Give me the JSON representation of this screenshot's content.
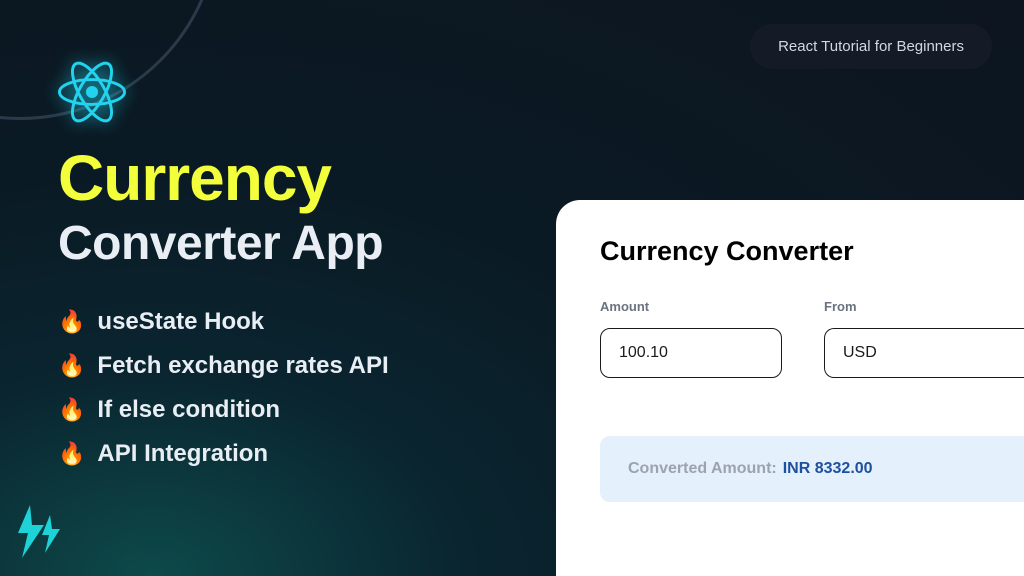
{
  "badge": {
    "label": "React Tutorial for Beginners"
  },
  "title": {
    "line1": "Currency",
    "line2": "Converter App"
  },
  "features": [
    {
      "text": "useState Hook"
    },
    {
      "text": "Fetch exchange rates API"
    },
    {
      "text": "If else condition"
    },
    {
      "text": "API Integration"
    }
  ],
  "card": {
    "heading": "Currency Converter",
    "amount_label": "Amount",
    "amount_value": "100.10",
    "from_label": "From",
    "from_value": "USD",
    "result_label": "Converted Amount:",
    "result_value": "INR 8332.00"
  }
}
